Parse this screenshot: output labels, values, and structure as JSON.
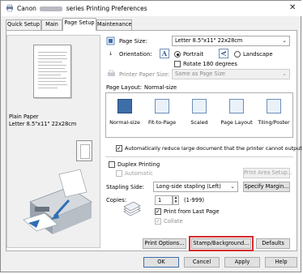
{
  "window": {
    "title_prefix": "Canon",
    "title_suffix": "series Printing Preferences",
    "close_glyph": "✕"
  },
  "tabs": [
    {
      "label": "Quick Setup"
    },
    {
      "label": "Main"
    },
    {
      "label": "Page Setup"
    },
    {
      "label": "Maintenance"
    }
  ],
  "preview": {
    "media_line1": "Plain Paper",
    "media_line2": "Letter 8.5\"x11\" 22x28cm"
  },
  "page_size": {
    "label": "Page Size:",
    "value": "Letter 8.5\"x11\" 22x28cm"
  },
  "orientation": {
    "label": "Orientation:",
    "portrait": "Portrait",
    "landscape": "Landscape",
    "selected": "portrait",
    "rotate_label": "Rotate 180 degrees"
  },
  "printer_paper_size": {
    "label": "Printer Paper Size:",
    "value": "Same as Page Size"
  },
  "page_layout": {
    "label": "Page Layout:",
    "current": "Normal-size",
    "items": [
      {
        "label": "Normal-size"
      },
      {
        "label": "Fit-to-Page"
      },
      {
        "label": "Scaled"
      },
      {
        "label": "Page Layout"
      },
      {
        "label": "Tiling/Poster"
      }
    ]
  },
  "auto_reduce": {
    "label": "Automatically reduce large document that the printer cannot output",
    "checked": true
  },
  "duplex": {
    "label": "Duplex Printing",
    "automatic_label": "Automatic",
    "print_area_button": "Print Area Setup..."
  },
  "stapling": {
    "label": "Stapling Side:",
    "value": "Long-side stapling (Left)",
    "margin_button": "Specify Margin..."
  },
  "copies": {
    "label": "Copies:",
    "value": "1",
    "range": "(1-999)",
    "print_from_last": "Print from Last Page",
    "collate": "Collate"
  },
  "bottom_buttons": {
    "print_options": "Print Options...",
    "stamp_background": "Stamp/Background...",
    "defaults": "Defaults"
  },
  "dialog_buttons": {
    "ok": "OK",
    "cancel": "Cancel",
    "apply": "Apply",
    "help": "Help"
  },
  "colors": {
    "highlight": "#d62b2b",
    "accent": "#3e6ea8"
  }
}
